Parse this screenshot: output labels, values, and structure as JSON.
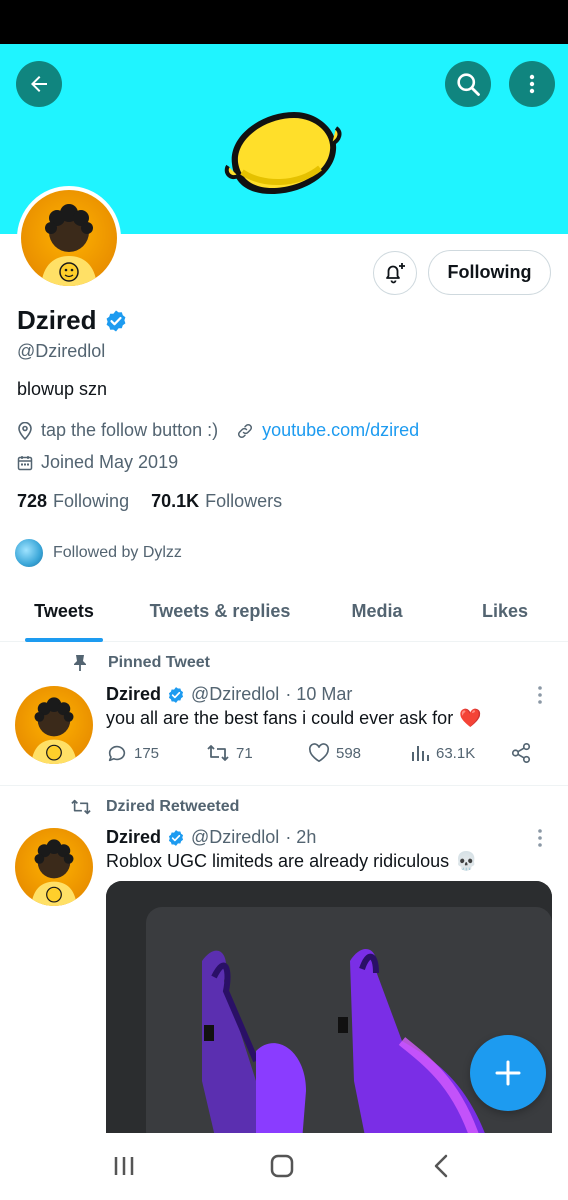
{
  "profile": {
    "display_name": "Dzired",
    "handle": "@Dziredlol",
    "bio": "blowup szn",
    "location": "tap the follow button :)",
    "website": "youtube.com/dzired",
    "joined": "Joined May 2019",
    "following_count": "728",
    "following_label": "Following",
    "followers_count": "70.1K",
    "followers_label": "Followers",
    "followed_by": "Followed by Dylzz",
    "follow_button_label": "Following"
  },
  "tabs": [
    {
      "label": "Tweets",
      "active": true
    },
    {
      "label": "Tweets & replies",
      "active": false
    },
    {
      "label": "Media",
      "active": false
    },
    {
      "label": "Likes",
      "active": false
    }
  ],
  "tweets": [
    {
      "context": "Pinned Tweet",
      "name": "Dzired",
      "handle": "@Dziredlol",
      "time": "· 10 Mar",
      "text": "you all are the best fans i could ever ask for",
      "emoji": "❤️",
      "replies": "175",
      "retweets": "71",
      "likes": "598",
      "views": "63.1K"
    },
    {
      "context": "Dzired Retweeted",
      "name": "Dzired",
      "handle": "@Dziredlol",
      "time": "· 2h",
      "text": "Roblox UGC limiteds are already ridiculous",
      "emoji": "💀"
    }
  ],
  "colors": {
    "banner": "#1ff4ff",
    "accent": "#1d9bf0",
    "header_buttons": "#10857f"
  },
  "icons": [
    "back-arrow-icon",
    "search-icon",
    "more-vertical-icon",
    "bell-plus-icon",
    "verified-badge-icon",
    "location-pin-icon",
    "link-icon",
    "calendar-icon",
    "pin-icon",
    "retweet-icon",
    "reply-icon",
    "like-icon",
    "views-icon",
    "share-icon",
    "compose-plus-icon",
    "recent-apps-icon",
    "home-icon",
    "back-nav-icon"
  ]
}
